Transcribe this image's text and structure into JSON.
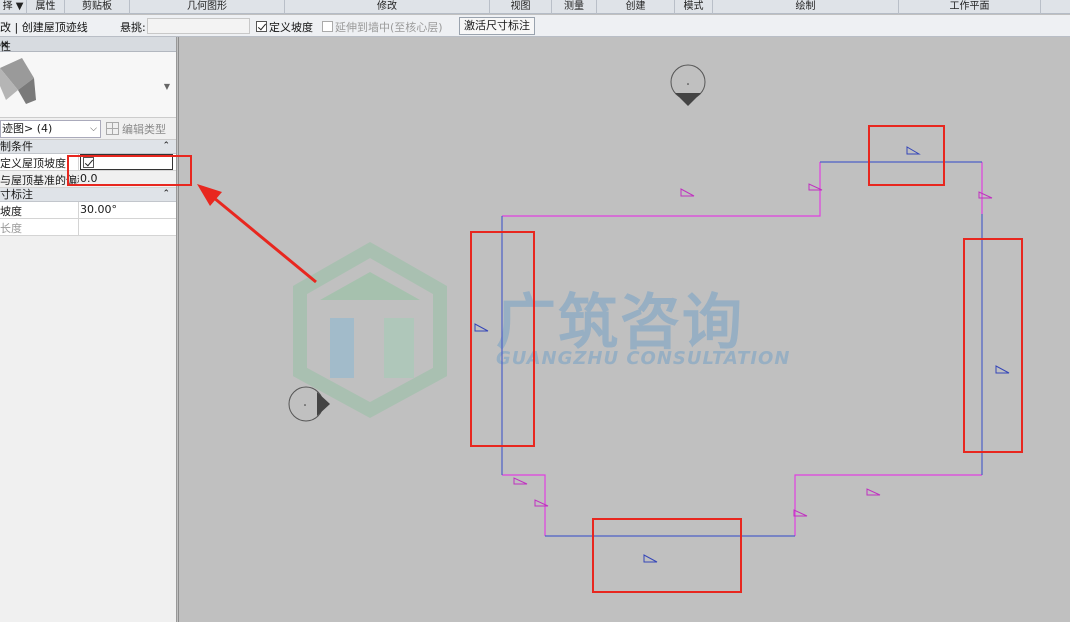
{
  "ribbon": {
    "panels": [
      "择 ▼",
      "属性",
      "剪贴板",
      "几何图形",
      "修改",
      "视图",
      "测量",
      "创建",
      "模式",
      "绘制",
      "工作平面"
    ]
  },
  "options_bar": {
    "mode_label": "改 | 创建屋顶迹线",
    "overhang_label": "悬挑:",
    "overhang_value": "",
    "define_slope_label": "定义坡度",
    "define_slope_checked": true,
    "extend_label": "延伸到墙中(至核心层)",
    "extend_checked": false,
    "activate_dim_button": "激活尺寸标注"
  },
  "properties": {
    "title": "性",
    "close": "×",
    "type_selector_value": "迹图> (4)",
    "edit_type_label": "编辑类型",
    "sections": [
      {
        "label": "制条件",
        "rows": [
          {
            "key": "定义屋顶坡度",
            "value": ""
          },
          {
            "key": "与屋顶基准的偏移",
            "value": "0.0"
          }
        ]
      },
      {
        "label": "寸标注",
        "rows": [
          {
            "key": "坡度",
            "value": "30.00°"
          },
          {
            "key": "长度",
            "value": ""
          }
        ]
      }
    ]
  },
  "watermark": {
    "cn": "广筑咨询",
    "en": "GUANGZHU CONSULTATION"
  },
  "colors": {
    "sketch_line": "#4d5fc7",
    "magenta_line": "#e040e0",
    "highlight": "#e8271f"
  }
}
